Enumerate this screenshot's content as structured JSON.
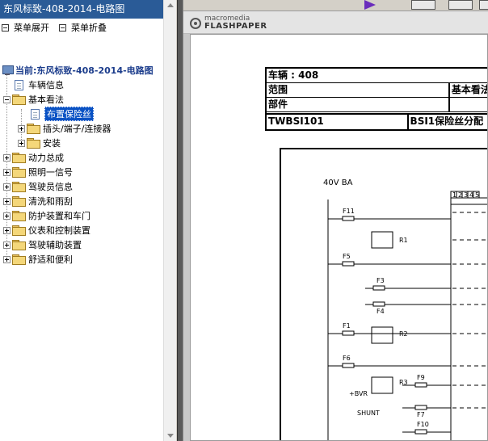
{
  "left_panel": {
    "title": "东风标致-408-2014-电路图",
    "menu": {
      "expand_label": "菜单展开",
      "collapse_label": "菜单折叠"
    },
    "tree": {
      "root_label": "当前:东风标致-408-2014-电路图",
      "items": [
        {
          "label": "车辆信息"
        },
        {
          "label": "基本看法"
        },
        {
          "label": "布置保险丝"
        },
        {
          "label": "插头/端子/连接器"
        },
        {
          "label": "安装"
        },
        {
          "label": "动力总成"
        },
        {
          "label": "照明一信号"
        },
        {
          "label": "驾驶员信息"
        },
        {
          "label": "清洗和雨刮"
        },
        {
          "label": "防护装置和车门"
        },
        {
          "label": "仪表和控制装置"
        },
        {
          "label": "驾驶辅助装置"
        },
        {
          "label": "舒适和便利"
        }
      ]
    }
  },
  "viewer": {
    "brand_line1": "macromedia",
    "brand_line2": "FLASHPAPER",
    "document": {
      "row1": "车辆 : 408",
      "row2_left": "范围",
      "row2_right": "基本看法",
      "row3_left": "部件",
      "row4_left": "TWBSI101",
      "row4_right": "BSI1保险丝分配",
      "diagram_title": "40V BA",
      "fuse_labels": [
        "F11",
        "F5",
        "F3",
        "F4",
        "F1",
        "F6",
        "F9",
        "F7",
        "F10"
      ],
      "relay_labels": [
        "R1",
        "R2",
        "R3"
      ],
      "terminal_numbers": [
        "1",
        "2",
        "3",
        "4",
        "5"
      ],
      "misc_labels": [
        "+BVR",
        "SHUNT"
      ]
    }
  },
  "colors": {
    "title_bar": "#2a5b97",
    "selection": "#0a52c4",
    "play_icon": "#6a2cbc"
  }
}
